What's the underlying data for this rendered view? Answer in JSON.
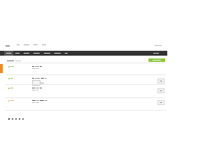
{
  "topbar": {
    "links": [
      "",
      "",
      "",
      ""
    ],
    "right_link": ""
  },
  "nav": {
    "items": [
      "",
      "",
      "",
      "",
      "",
      "",
      ""
    ],
    "right": ""
  },
  "section": {
    "title": "",
    "subtitle": "",
    "add_button": ""
  },
  "rows": [
    {
      "status": "",
      "title": "",
      "meta": "",
      "action": ""
    },
    {
      "status": "",
      "title": "",
      "meta": "",
      "action": ""
    },
    {
      "status": "",
      "title": "",
      "meta": "",
      "action": ""
    },
    {
      "status": "",
      "title": "",
      "meta": "",
      "action": ""
    }
  ],
  "pager": {
    "pages": [
      "",
      "",
      "",
      "",
      ""
    ]
  },
  "colors": {
    "nav_bg": "#333333",
    "accent_green": "#8dc63f",
    "side_tab_orange": "#f08a24"
  }
}
